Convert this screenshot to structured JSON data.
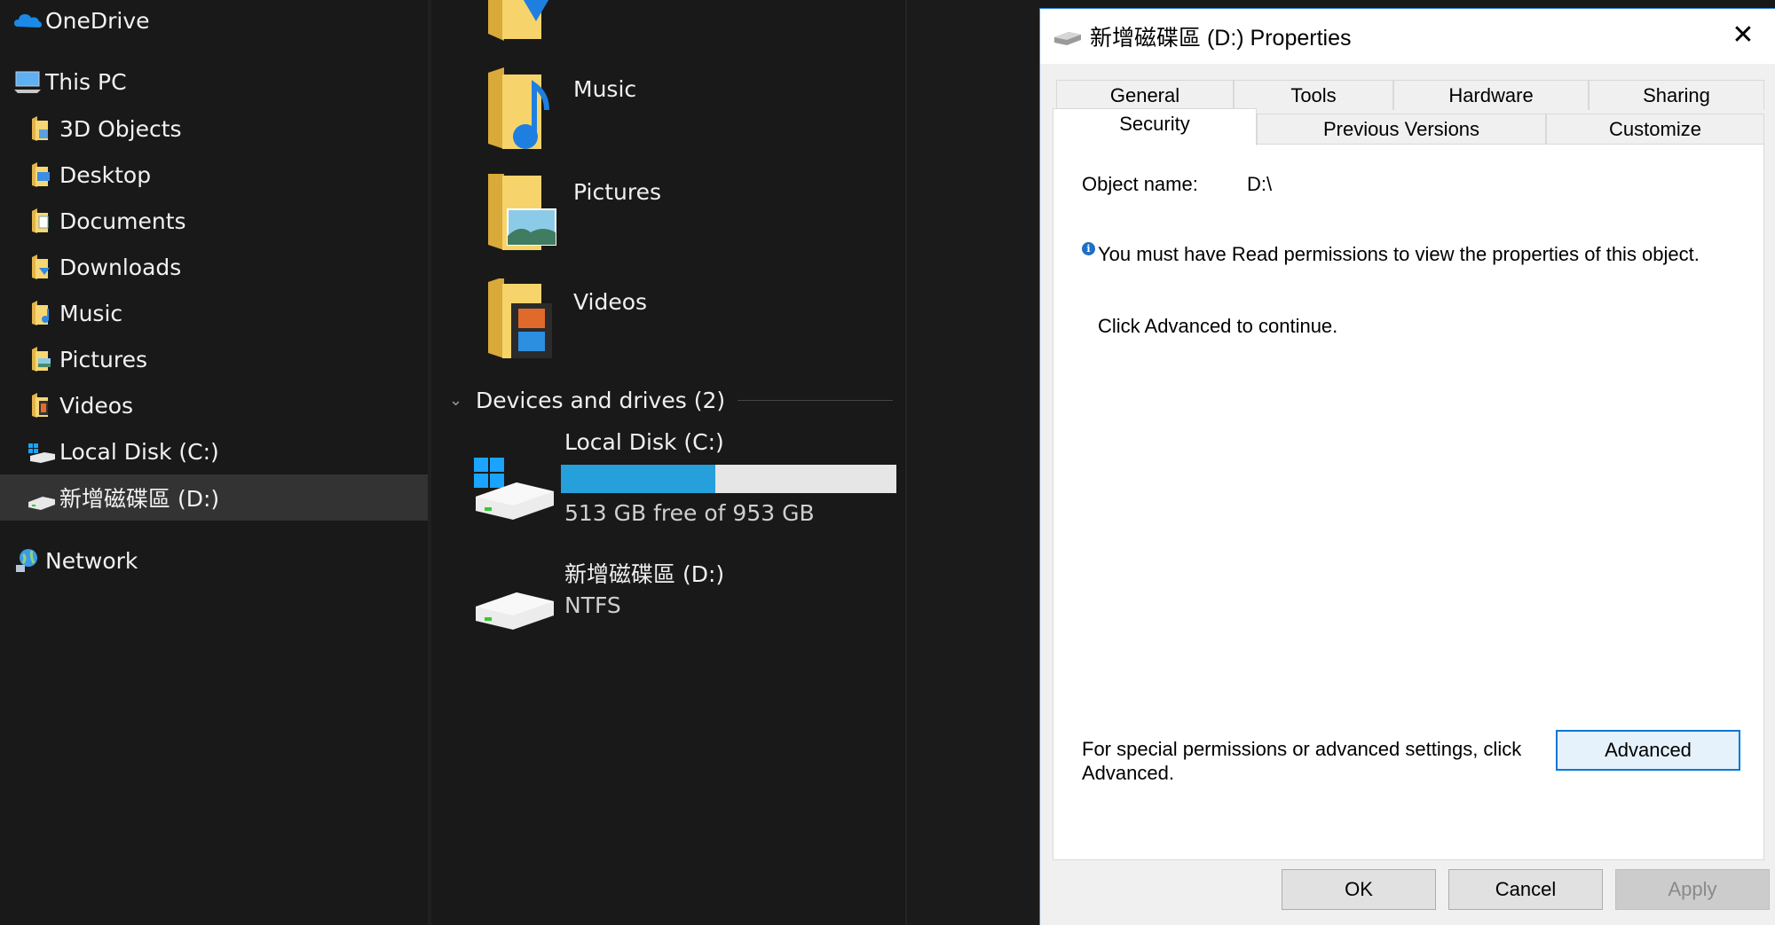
{
  "nav": {
    "items": [
      {
        "label": "OneDrive",
        "icon": "onedrive-cloud-icon"
      },
      {
        "label": "This PC",
        "icon": "this-pc-icon"
      },
      {
        "label": "3D Objects",
        "icon": "folder-3d-objects-icon"
      },
      {
        "label": "Desktop",
        "icon": "folder-desktop-icon"
      },
      {
        "label": "Documents",
        "icon": "folder-documents-icon"
      },
      {
        "label": "Downloads",
        "icon": "folder-downloads-icon"
      },
      {
        "label": "Music",
        "icon": "folder-music-icon"
      },
      {
        "label": "Pictures",
        "icon": "folder-pictures-icon"
      },
      {
        "label": "Videos",
        "icon": "folder-videos-icon"
      },
      {
        "label": "Local Disk (C:)",
        "icon": "windows-drive-icon"
      },
      {
        "label": "新增磁碟區 (D:)",
        "icon": "drive-icon"
      },
      {
        "label": "Network",
        "icon": "network-icon"
      }
    ],
    "selected_index": 10
  },
  "content": {
    "folders": [
      {
        "label": "Music"
      },
      {
        "label": "Pictures"
      },
      {
        "label": "Videos"
      }
    ],
    "group_header": "Devices and drives (2)",
    "drives": [
      {
        "name": "Local Disk (C:)",
        "detail": "513 GB free of 953 GB",
        "used_fraction": 0.46
      },
      {
        "name": "新增磁碟區 (D:)",
        "detail": "NTFS"
      }
    ]
  },
  "dialog": {
    "title": "新增磁碟區 (D:) Properties",
    "close_glyph": "✕",
    "tabs_row1": [
      "General",
      "Tools",
      "Hardware",
      "Sharing"
    ],
    "tabs_row2": [
      "Security",
      "Previous Versions",
      "Customize"
    ],
    "active_tab": "Security",
    "object_name_label": "Object name:",
    "object_name_value": "D:\\",
    "info_glyph": "i",
    "message": "You must have Read permissions to view the properties of this object.",
    "message2": "Click Advanced to continue.",
    "advanced_text": "For special permissions or advanced settings, click Advanced.",
    "advanced_button": "Advanced",
    "ok_button": "OK",
    "cancel_button": "Cancel",
    "apply_button": "Apply"
  },
  "colors": {
    "accent": "#0078d7",
    "progress": "#26a0da",
    "background": "#191919",
    "selected_row": "#333333"
  }
}
